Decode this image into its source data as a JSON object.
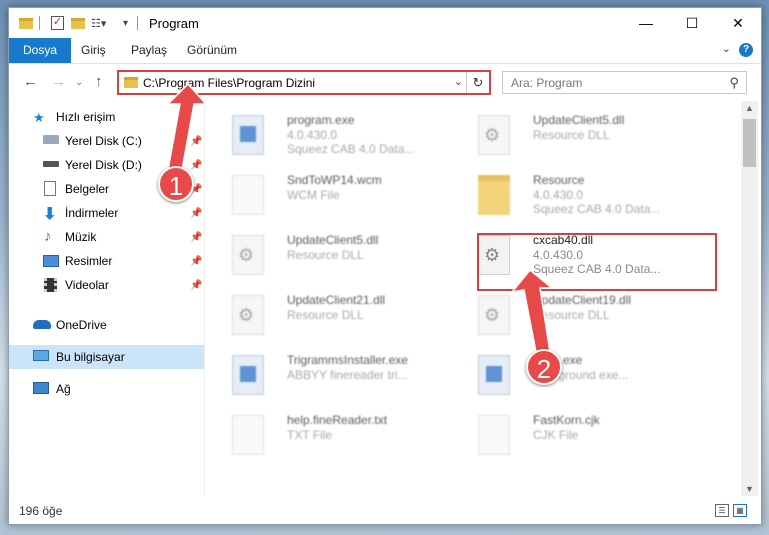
{
  "window": {
    "title": "Program"
  },
  "ribbon": {
    "tabs": [
      "Dosya",
      "Giriş",
      "Paylaş",
      "Görünüm"
    ],
    "help": "?"
  },
  "address": {
    "path": "C:\\Program Files\\Program Dizini"
  },
  "search": {
    "placeholder": "Ara: Program"
  },
  "nav": {
    "items": [
      {
        "label": "Hızlı erişim",
        "icon": "star-icon"
      },
      {
        "label": "Yerel Disk (C:)",
        "icon": "drive-icon"
      },
      {
        "label": "Yerel Disk (D:)",
        "icon": "drive-icon"
      },
      {
        "label": "Belgeler",
        "icon": "documents-icon"
      },
      {
        "label": "İndirmeler",
        "icon": "download-icon"
      },
      {
        "label": "Müzik",
        "icon": "music-icon"
      },
      {
        "label": "Resimler",
        "icon": "pictures-icon"
      },
      {
        "label": "Videolar",
        "icon": "videos-icon"
      },
      {
        "label": "OneDrive",
        "icon": "cloud-icon"
      },
      {
        "label": "Bu bilgisayar",
        "icon": "computer-icon"
      },
      {
        "label": "Ağ",
        "icon": "network-icon"
      }
    ]
  },
  "files": [
    {
      "name": "program.exe",
      "l2": "4.0.430.0",
      "l3": "Squeez CAB 4.0 Data..."
    },
    {
      "name": "UpdateClient5.dll",
      "l2": "Resource DLL",
      "l3": ""
    },
    {
      "name": "SndToWP14.wcm",
      "l2": "WCM File",
      "l3": ""
    },
    {
      "name": "Resource",
      "l2": "4.0.430.0",
      "l3": "Squeez CAB 4.0 Data..."
    },
    {
      "name": "UpdateClient5.dll",
      "l2": "Resource DLL",
      "l3": ""
    },
    {
      "name": "cxcab40.dll",
      "l2": "4.0.430.0",
      "l3": "Squeez CAB 4.0 Data..."
    },
    {
      "name": "UpdateClient21.dll",
      "l2": "Resource DLL",
      "l3": ""
    },
    {
      "name": "UpdateClient19.dll",
      "l2": "Resource DLL",
      "l3": ""
    },
    {
      "name": "TrigrammsInstaller.exe",
      "l2": "ABBYY finereader tri...",
      "l3": ""
    },
    {
      "name": "Exec.exe",
      "l2": "background exe...",
      "l3": ""
    },
    {
      "name": "help.fineReader.txt",
      "l2": "TXT File",
      "l3": ""
    },
    {
      "name": "FastKorn.cjk",
      "l2": "CJK File",
      "l3": ""
    }
  ],
  "status": {
    "count": "196 öğe"
  },
  "annotations": {
    "badge1": "1",
    "badge2": "2",
    "color": "#e84a4a"
  }
}
